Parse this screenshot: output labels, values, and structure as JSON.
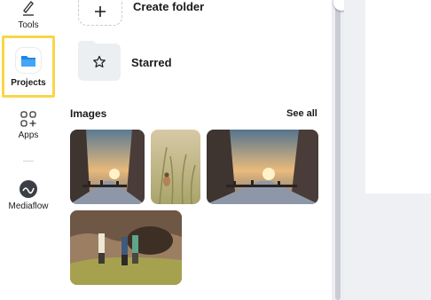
{
  "sidebar": {
    "items": [
      {
        "label": "Tools",
        "icon": "pen-tools-icon"
      },
      {
        "label": "Projects",
        "icon": "folder-icon"
      },
      {
        "label": "Apps",
        "icon": "apps-grid-icon"
      },
      {
        "label": "Mediaflow",
        "icon": "mediaflow-icon"
      }
    ]
  },
  "folders": {
    "create_label": "Create folder",
    "starred_label": "Starred"
  },
  "images": {
    "title": "Images",
    "see_all": "See all"
  },
  "colors": {
    "highlight": "#f7d64a",
    "folder_blue": "#1e88e5"
  }
}
